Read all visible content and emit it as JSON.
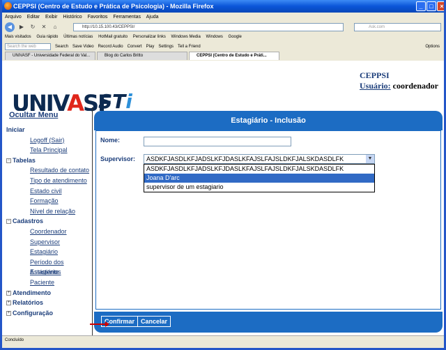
{
  "window": {
    "title": "CEPPSI (Centro de Estudo e Prática de Psicologia) - Mozilla Firefox"
  },
  "menubar": [
    "Arquivo",
    "Editar",
    "Exibir",
    "Histórico",
    "Favoritos",
    "Ferramentas",
    "Ajuda"
  ],
  "navbar": {
    "url": "http://10.15.100.43/CEPPSI/",
    "search_placeholder": "Ask.com"
  },
  "bookmarks": [
    "Mais visitados",
    "Guia rápido",
    "Últimas notícias",
    "HotMail gratuito",
    "Personalizar links",
    "Windows Media",
    "Windows",
    "Google"
  ],
  "toolbar": {
    "search_placeholder": "Search the web",
    "items": [
      "Search",
      "Save Video",
      "Record Audio",
      "Convert",
      "Play",
      "Settings",
      "Tell a Friend",
      "Options"
    ]
  },
  "tabs": [
    "UNIVASF - Universidade Federal do Val...",
    "Blog do Carlos Britto",
    "CEPPSI (Centro de Estudo e Práti..."
  ],
  "header": {
    "logo_left_a": "UNIV",
    "logo_left_b": "A",
    "logo_left_c": "SF",
    "logo_right_a": "ST",
    "logo_right_b": "i",
    "app": "CEPPSI",
    "user_label": "Usuário:",
    "user_name": "coordenador"
  },
  "sidebar": {
    "hide_menu": "Ocultar Menu",
    "sections": [
      {
        "label": "Iniciar",
        "expanded": true,
        "items": [
          "Logoff (Sair)",
          "Tela Principal"
        ]
      },
      {
        "label": "Tabelas",
        "expanded": true,
        "items": [
          "Resultado de contato",
          "Tipo de atendimento",
          "Estado civil",
          "Formação",
          "Nível de relação"
        ]
      },
      {
        "label": "Cadastros",
        "expanded": true,
        "items": [
          "Coordenador",
          "Supervisor",
          "Estagiário",
          "Período dos Estagiários",
          "Assistente",
          "Paciente"
        ]
      },
      {
        "label": "Atendimento",
        "expanded": false,
        "items": []
      },
      {
        "label": "Relatórios",
        "expanded": false,
        "items": []
      },
      {
        "label": "Configuração",
        "expanded": false,
        "items": []
      }
    ]
  },
  "form": {
    "title": "Estagiário - Inclusão",
    "name_label": "Nome:",
    "name_value": "",
    "supervisor_label": "Supervisor:",
    "supervisor_selected": "ASDKFJASDLKFJADSLKFJDASLKFAJSLFAJSLDKFJALSKDASDLFK",
    "supervisor_options": [
      "ASDKFJASDLKFJADSLKFJDASLKFAJSLFAJSLDKFJALSKDASDLFK",
      "Joana D'arc",
      "supervisor de um estagiario"
    ],
    "highlighted_option": 1,
    "confirm_label": "Confirmar",
    "cancel_label": "Cancelar"
  },
  "status": "Concluído",
  "colors": {
    "panel": "#1c6cc3",
    "link": "#1b3d7a",
    "selection": "#316ac5"
  }
}
